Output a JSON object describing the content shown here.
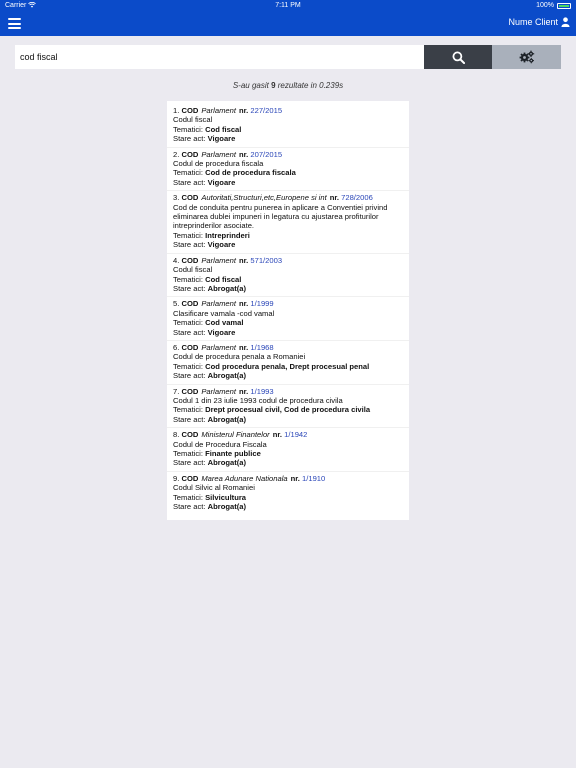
{
  "status_bar": {
    "carrier": "Carrier",
    "time": "7:11 PM",
    "battery": "100%"
  },
  "nav": {
    "client_label": "Nume Client"
  },
  "search": {
    "query": "cod fiscal"
  },
  "summary": {
    "prefix": "S-au gasit ",
    "count": "9",
    "suffix": " rezultate in 0.239s"
  },
  "labels": {
    "nr": "nr.",
    "tematici": "Tematici:",
    "stare": "Stare act:"
  },
  "results": [
    {
      "index": "1.",
      "type": "COD",
      "issuer": "Parlament",
      "number": "227/2015",
      "title": "Codul fiscal",
      "topics": "Cod fiscal",
      "status": "Vigoare"
    },
    {
      "index": "2.",
      "type": "COD",
      "issuer": "Parlament",
      "number": "207/2015",
      "title": "Codul de procedura fiscala",
      "topics": "Cod de procedura fiscala",
      "status": "Vigoare"
    },
    {
      "index": "3.",
      "type": "COD",
      "issuer": "Autoritati,Structuri,etc,Europene si int",
      "number": "728/2006",
      "title": "Cod de conduita pentru punerea in aplicare a Conventiei privind eliminarea dublei impuneri in legatura cu ajustarea profiturilor intreprinderilor asociate.",
      "topics": "Intreprinderi",
      "status": "Vigoare"
    },
    {
      "index": "4.",
      "type": "COD",
      "issuer": "Parlament",
      "number": "571/2003",
      "title": "Codul fiscal",
      "topics": "Cod fiscal",
      "status": "Abrogat(a)"
    },
    {
      "index": "5.",
      "type": "COD",
      "issuer": "Parlament",
      "number": "1/1999",
      "title": "Clasificare vamala -cod vamal",
      "topics": "Cod vamal",
      "status": "Vigoare"
    },
    {
      "index": "6.",
      "type": "COD",
      "issuer": "Parlament",
      "number": "1/1968",
      "title": "Codul de procedura penala a Romaniei",
      "topics": "Cod procedura penala, Drept procesual penal",
      "status": "Abrogat(a)"
    },
    {
      "index": "7.",
      "type": "COD",
      "issuer": "Parlament",
      "number": "1/1993",
      "title": "Codul 1 din 23 iulie 1993 codul de procedura civila",
      "topics": "Drept procesual civil, Cod de procedura civila",
      "status": "Abrogat(a)"
    },
    {
      "index": "8.",
      "type": "COD",
      "issuer": "Ministerul Finantelor",
      "number": "1/1942",
      "title": "Codul de Procedura Fiscala",
      "topics": "Finante publice",
      "status": "Abrogat(a)"
    },
    {
      "index": "9.",
      "type": "COD",
      "issuer": "Marea Adunare Nationala",
      "number": "1/1910",
      "title": "Codul Silvic al Romaniei",
      "topics": "Silvicultura",
      "status": "Abrogat(a)"
    }
  ],
  "icons": {
    "menu": "hamburger-icon",
    "user": "user-icon",
    "search": "search-icon",
    "settings": "gears-icon",
    "wifi": "wifi-icon",
    "battery": "battery-icon"
  },
  "colors": {
    "nav": "#0b4bc9",
    "link": "#2a46b8",
    "search_button": "#3a3f47",
    "settings_button": "#a9b0bb",
    "background": "#ebeaf0"
  }
}
